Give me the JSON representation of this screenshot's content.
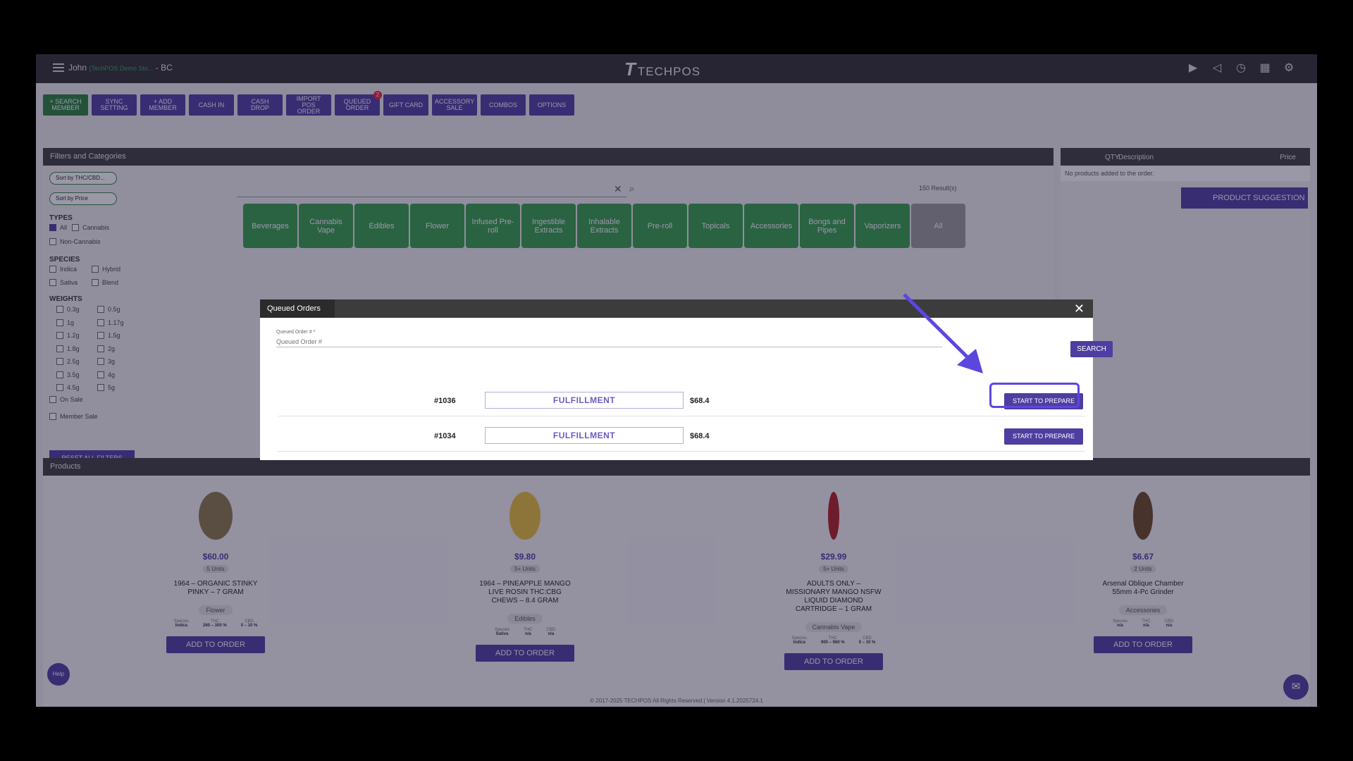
{
  "header": {
    "user": "John",
    "store": "(TechPOS Demo Sto...",
    "province": "- BC",
    "logo": "TECHPOS",
    "icons": [
      "video-icon",
      "megaphone-icon",
      "clock-icon",
      "calendar-icon",
      "gear-icon"
    ]
  },
  "toolbar": {
    "search_member": "+ SEARCH MEMBER",
    "sync_setting": "SYNC SETTING",
    "add_member": "+ ADD MEMBER",
    "cash_in": "CASH IN",
    "cash_drop": "CASH DROP",
    "import_pos": "IMPORT POS ORDER",
    "queued_order": "QUEUED ORDER",
    "queued_badge": "2",
    "gift_card": "GIFT CARD",
    "accessory_sale": "ACCESSORY SALE",
    "combos": "COMBOS",
    "options": "OPTIONS"
  },
  "filters": {
    "title": "Filters and Categories",
    "sort_thc": "Sort by THC/CBD...",
    "sort_price": "Sort by Price",
    "types_title": "TYPES",
    "types": [
      "All",
      "Cannabis",
      "Non-Cannabis"
    ],
    "species_title": "SPECIES",
    "species": [
      "Indica",
      "Hybrid",
      "Sativa",
      "Blend"
    ],
    "weights_title": "WEIGHTS",
    "weights": [
      "0.3g",
      "0.5g",
      "1g",
      "1.17g",
      "1.2g",
      "1.5g",
      "1.8g",
      "2g",
      "2.5g",
      "3g",
      "3.5g",
      "4g",
      "4.5g",
      "5g"
    ],
    "on_sale": "On Sale",
    "member_sale": "Member Sale",
    "reset": "RESET ALL FILTERS",
    "results": "150 Result(s)"
  },
  "categories": [
    "Beverages",
    "Cannabis Vape",
    "Edibles",
    "Flower",
    "Infused Pre-roll",
    "Ingestible Extracts",
    "Inhalable Extracts",
    "Pre-roll",
    "Topicals",
    "Accessories",
    "Bongs and Pipes",
    "Vaporizers",
    "All"
  ],
  "order": {
    "col_qty": "QTY",
    "col_desc": "Description",
    "col_price": "Price",
    "empty": "No products added to the order.",
    "suggestion": "PRODUCT SUGGESTION"
  },
  "products": {
    "title": "Products",
    "add_label": "ADD TO ORDER",
    "items": [
      {
        "price": "$60.00",
        "units": "5 Units",
        "name": "1964 – ORGANIC STINKY PINKY – 7 GRAM",
        "tag": "Flower",
        "species": "Indica",
        "thc": "260 – 300 %",
        "cbd": "0 – 10 %"
      },
      {
        "price": "$9.80",
        "units": "5+ Units",
        "name": "1964 – PINEAPPLE MANGO LIVE ROSIN THC:CBG CHEWS – 8.4 GRAM",
        "tag": "Edibles",
        "species": "Sativa",
        "thc": "n/a",
        "cbd": "n/a"
      },
      {
        "price": "$29.99",
        "units": "5+ Units",
        "name": "ADULTS ONLY – MISSIONARY MANGO NSFW LIQUID DIAMOND CARTRIDGE – 1 GRAM",
        "tag": "Cannabis Vape",
        "species": "Indica",
        "thc": "900 – 960 %",
        "cbd": "0 – 10 %"
      },
      {
        "price": "$6.67",
        "units": "2 Units",
        "name": "Arsenal Oblique Chamber 55mm 4-Pc Grinder",
        "tag": "Accessories",
        "species": "n/a",
        "thc": "n/a",
        "cbd": "n/a"
      }
    ],
    "meta_labels": {
      "species": "Species",
      "thc": "THC",
      "cbd": "CBD"
    }
  },
  "footer": "© 2017-2025 TECHPOS All Rights Reserved | Version 4.1.2025724.1",
  "help": "Help",
  "modal": {
    "title": "Queued Orders",
    "field_label": "Queued Order # *",
    "field_placeholder": "Queued Order #",
    "search": "SEARCH",
    "rows": [
      {
        "num": "#1036",
        "status": "FULFILLMENT",
        "price": "$68.4",
        "action": "START TO PREPARE"
      },
      {
        "num": "#1034",
        "status": "FULFILLMENT",
        "price": "$68.4",
        "action": "START TO PREPARE"
      }
    ]
  },
  "colors": {
    "primary": "#4e3ea0",
    "green": "#33a048",
    "highlight": "#5b47e0"
  }
}
